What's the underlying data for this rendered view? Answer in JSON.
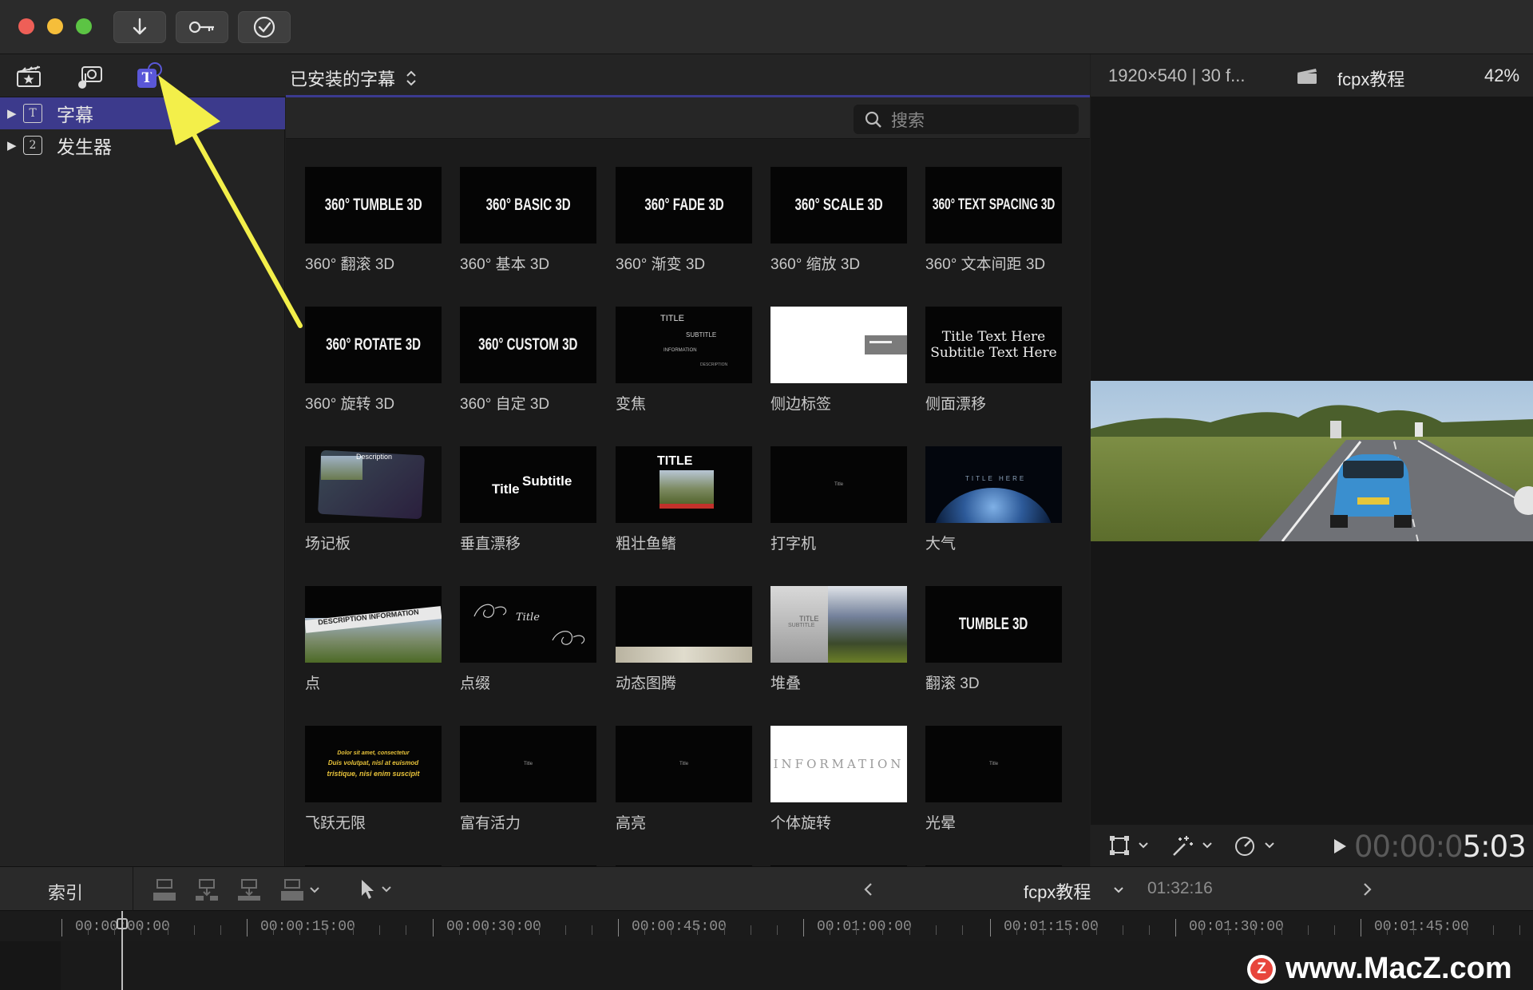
{
  "library": {
    "dropdown_label": "已安装的字幕",
    "sidebar": [
      {
        "label": "字幕",
        "icon": "T",
        "selected": true
      },
      {
        "label": "发生器",
        "icon": "2",
        "selected": false
      }
    ],
    "search_placeholder": "搜索"
  },
  "tiles": [
    {
      "thumb": "360° TUMBLE 3D",
      "label": "360° 翻滚 3D"
    },
    {
      "thumb": "360° BASIC 3D",
      "label": "360° 基本 3D"
    },
    {
      "thumb": "360° FADE 3D",
      "label": "360° 渐变 3D"
    },
    {
      "thumb": "360° SCALE 3D",
      "label": "360° 缩放 3D"
    },
    {
      "thumb": "360° TEXT SPACING 3D",
      "label": "360° 文本间距 3D"
    },
    {
      "thumb": "360° ROTATE 3D",
      "label": "360° 旋转 3D"
    },
    {
      "thumb": "360° CUSTOM 3D",
      "label": "360° 自定 3D"
    },
    {
      "thumb": "TITLE|SUBTITLE|INFORMATION|DESCRIPTION",
      "label": "变焦"
    },
    {
      "thumb": "",
      "label": "侧边标签"
    },
    {
      "thumb": "Title Text Here|Subtitle Text Here",
      "label": "侧面漂移"
    },
    {
      "thumb": "Description",
      "label": "场记板"
    },
    {
      "thumb": "Title|Subtitle",
      "label": "垂直漂移"
    },
    {
      "thumb": "TITLE",
      "label": "粗壮鱼鳍"
    },
    {
      "thumb": "Title",
      "label": "打字机"
    },
    {
      "thumb": "TITLE HERE",
      "label": "大气"
    },
    {
      "thumb": "DESCRIPTION INFORMATION",
      "label": "点"
    },
    {
      "thumb": "Title",
      "label": "点缀"
    },
    {
      "thumb": "",
      "label": "动态图腾"
    },
    {
      "thumb": "TITLE|SUBTITLE",
      "label": "堆叠"
    },
    {
      "thumb": "TUMBLE 3D",
      "label": "翻滚 3D"
    },
    {
      "thumb": "Dolor sit amet, consectetur|Duis volutpat, nisl at euismod|tristique, nisi enim suscipit",
      "label": "飞跃无限"
    },
    {
      "thumb": "Title",
      "label": "富有活力"
    },
    {
      "thumb": "Title",
      "label": "高亮"
    },
    {
      "thumb": "INFORMATION",
      "label": "个体旋转"
    },
    {
      "thumb": "Title",
      "label": "光晕"
    }
  ],
  "viewer": {
    "format": "1920×540 | 30 f...",
    "project": "fcpx教程",
    "zoom": "42%",
    "timecode_dim": "00:00:0",
    "timecode_bright": "5:03"
  },
  "timeline": {
    "index_label": "索引",
    "project": "fcpx教程",
    "duration": "01:32:16",
    "ruler": [
      "00:00:00:00",
      "00:00:15:00",
      "00:00:30:00",
      "00:00:45:00",
      "00:01:00:00",
      "00:01:15:00",
      "00:01:30:00",
      "00:01:45:00"
    ]
  },
  "watermark": "www.MacZ.com",
  "colors": {
    "accent": "#3b3a8f",
    "selection": "#3c3a8c",
    "arrow": "#f3ef4a"
  }
}
